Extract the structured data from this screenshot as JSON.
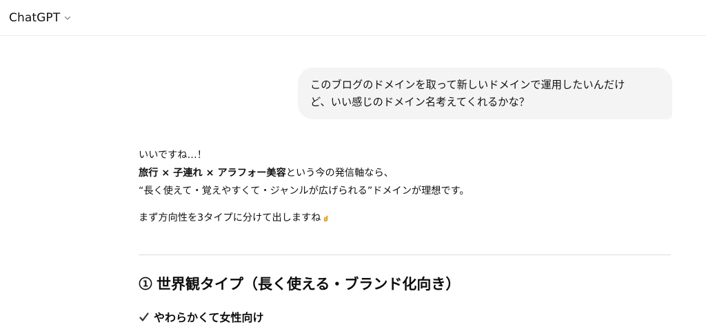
{
  "header": {
    "model_name": "ChatGPT"
  },
  "user_message": {
    "line1": "このブログのドメインを取って新しいドメインで運用したいんだけ",
    "line2": "ど、いい感じのドメイン名考えてくれるかな？"
  },
  "assistant": {
    "line1": "いいですね…！",
    "line2_bold": "旅行 × 子連れ × アラフォー美容",
    "line2_rest": "という今の発信軸なら、",
    "line3": "“長く使えて・覚えやすくて・ジャンルが広げられる”ドメインが理想です。",
    "line4": "まず方向性を3タイプに分けて出しますね",
    "section_title": "世界観タイプ（長く使える・ブランド化向き）",
    "check_item": "やわらかくて女性向け"
  },
  "icons": {
    "model_chevron": "chevron-down-icon",
    "hand": "pointing-down-hand-icon",
    "circled_number": "circled-number-one-icon",
    "check": "check-mark-icon"
  },
  "colors": {
    "bubble_bg": "#f4f4f4",
    "text": "#0d0d0d",
    "divider": "#dcdcdc",
    "hand": "#f6b73c"
  }
}
